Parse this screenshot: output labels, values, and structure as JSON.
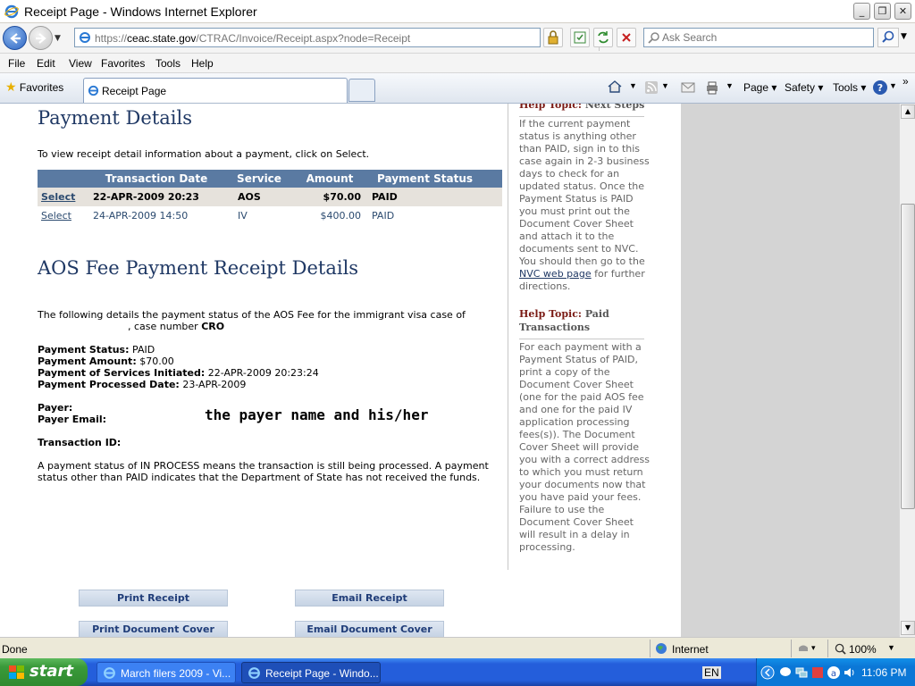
{
  "window": {
    "title": "Receipt Page - Windows Internet Explorer"
  },
  "address": {
    "url_prefix": "https://",
    "url_domain": "ceac.state.gov",
    "url_path": "/CTRAC/Invoice/Receipt.aspx?node=Receipt",
    "search_placeholder": "Ask Search"
  },
  "menu": [
    "File",
    "Edit",
    "View",
    "Favorites",
    "Tools",
    "Help"
  ],
  "favorites": {
    "label": "Favorites",
    "tab_title": "Receipt Page"
  },
  "commandbar": {
    "page": "Page",
    "safety": "Safety",
    "tools": "Tools"
  },
  "content": {
    "payment_title": "Payment Details",
    "payment_intro": "To view receipt detail information about a payment, click on Select.",
    "table_headers": [
      "Transaction Date",
      "Service",
      "Amount",
      "Payment Status"
    ],
    "rows": [
      {
        "select": "Select",
        "date": "22-APR-2009 20:23",
        "service": "AOS",
        "amount": "$70.00",
        "status": "PAID"
      },
      {
        "select": "Select",
        "date": "24-APR-2009 14:50",
        "service": "IV",
        "amount": "$400.00",
        "status": "PAID"
      }
    ],
    "receipt_title": "AOS Fee Payment Receipt Details",
    "receipt_intro": "The following details the payment status of the AOS Fee for the immigrant visa case of",
    "case_prefix": ", case number",
    "case_number": "CRO",
    "status_label": "Payment Status:",
    "status_value": "PAID",
    "amount_label": "Payment Amount:",
    "amount_value": "$70.00",
    "initiated_label": "Payment of Services Initiated:",
    "initiated_value": "22-APR-2009 20:23:24",
    "processed_label": "Payment Processed Date:",
    "processed_value": "23-APR-2009",
    "payer_label": "Payer:",
    "payer_email_label": "Payer Email:",
    "annotation": "the payer name and his/her",
    "transaction_label": "Transaction ID:",
    "note": "A payment status of IN PROCESS means the transaction is still being processed. A payment status other than PAID indicates that the Department of State has not received the funds.",
    "buttons": {
      "print_receipt": "Print Receipt",
      "email_receipt": "Email Receipt",
      "print_cover": "Print Document Cover Sheet",
      "email_cover": "Email Document Cover Sheet"
    }
  },
  "help": {
    "topic1_label": "Help Topic:",
    "topic1_name": "Next Steps",
    "topic1_text_before": "If the current payment status is anything other than PAID, sign in to this case again in 2-3 business days to check for an updated status. Once the Payment Status is PAID you must print out the Document Cover Sheet and attach it to the documents sent to NVC. You should then go to the",
    "topic1_link": "NVC web page",
    "topic1_text_after": "for further directions.",
    "topic2_label": "Help Topic:",
    "topic2_name": "Paid Transactions",
    "topic2_text": "For each payment with a Payment Status of PAID, print a copy of the Document Cover Sheet (one for the paid AOS fee and one for the paid IV application processing fees(s)). The Document Cover Sheet will provide you with a correct address to which you must return your documents now that you have paid your fees. Failure to use the Document Cover Sheet will result in a delay in processing."
  },
  "status": {
    "left": "Done",
    "zone": "Internet",
    "zoom": "100%"
  },
  "taskbar": {
    "start": "start",
    "task1": "March filers 2009 - Vi...",
    "task2": "Receipt Page - Windo...",
    "lang": "EN",
    "clock": "11:06 PM"
  },
  "colors": {
    "heading": "#1f3864",
    "table_header": "#5a7aa2",
    "help_heading": "#7a1a14",
    "taskbar": "#245edb"
  }
}
